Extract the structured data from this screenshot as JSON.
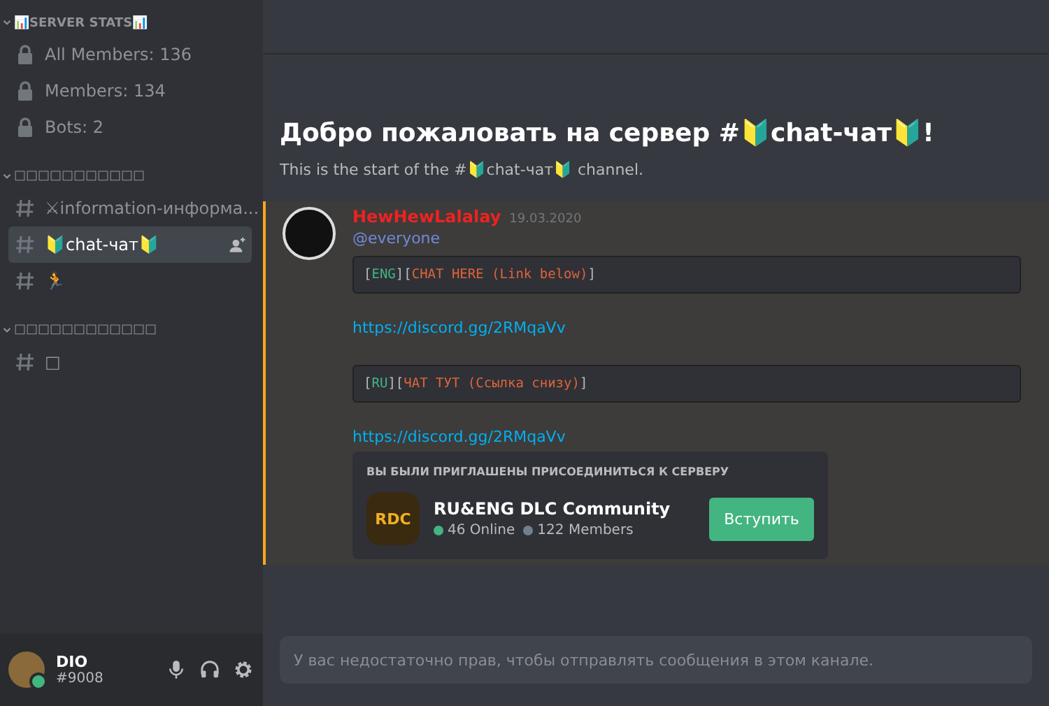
{
  "sidebar": {
    "categories": [
      {
        "name": "📊SERVER STATS📊",
        "expanded": true,
        "channels": [
          {
            "kind": "locked",
            "name": "All Members: 136",
            "selected": false
          },
          {
            "kind": "locked",
            "name": "Members: 134",
            "selected": false
          },
          {
            "kind": "locked",
            "name": "Bots: 2",
            "selected": false
          }
        ]
      },
      {
        "name": "□□□□□□□□□□□",
        "expanded": true,
        "channels": [
          {
            "kind": "text",
            "name": "⚔information-информа...",
            "selected": false
          },
          {
            "kind": "text",
            "name": "🔰chat-чат🔰",
            "selected": true
          },
          {
            "kind": "text",
            "name": "🏃",
            "selected": false
          }
        ]
      },
      {
        "name": "□□□□□□□□□□□□",
        "expanded": true,
        "channels": [
          {
            "kind": "text",
            "name": "□",
            "selected": false
          }
        ]
      }
    ]
  },
  "user": {
    "name": "DIO",
    "tag": "#9008"
  },
  "welcome": {
    "title": "Добро пожаловать на сервер #🔰chat-чат🔰!",
    "subtitle": "This is the start of the #🔰chat-чат🔰 channel."
  },
  "message": {
    "author": "HewHewLalalay",
    "date": "19.03.2020",
    "mention": "@everyone",
    "blocks": [
      {
        "kind": "code",
        "parts": [
          {
            "text": "[",
            "color": "#b9bbbe"
          },
          {
            "text": "ENG",
            "color": "#43b581"
          },
          {
            "text": "][",
            "color": "#b9bbbe"
          },
          {
            "text": "CHAT HERE (Link below)",
            "color": "#e0633a"
          },
          {
            "text": "]",
            "color": "#b9bbbe"
          }
        ]
      },
      {
        "kind": "link",
        "text": "https://discord.gg/2RMqaVv"
      },
      {
        "kind": "code",
        "parts": [
          {
            "text": "[",
            "color": "#b9bbbe"
          },
          {
            "text": "RU",
            "color": "#43b581"
          },
          {
            "text": "][",
            "color": "#b9bbbe"
          },
          {
            "text": "ЧАТ ТУТ (Ссылка снизу)",
            "color": "#e0633a"
          },
          {
            "text": "]",
            "color": "#b9bbbe"
          }
        ]
      },
      {
        "kind": "link",
        "text": "https://discord.gg/2RMqaVv"
      }
    ],
    "invite": {
      "heading": "ВЫ БЫЛИ ПРИГЛАШЕНЫ ПРИСОЕДИНИТЬСЯ К СЕРВЕРУ",
      "logo": "RDC",
      "server": "RU&ENG DLC Community",
      "online": "46 Online",
      "members": "122 Members",
      "button": "Вступить"
    }
  },
  "composer": {
    "placeholder": "У вас недостаточно прав, чтобы отправлять сообщения в этом канале."
  }
}
